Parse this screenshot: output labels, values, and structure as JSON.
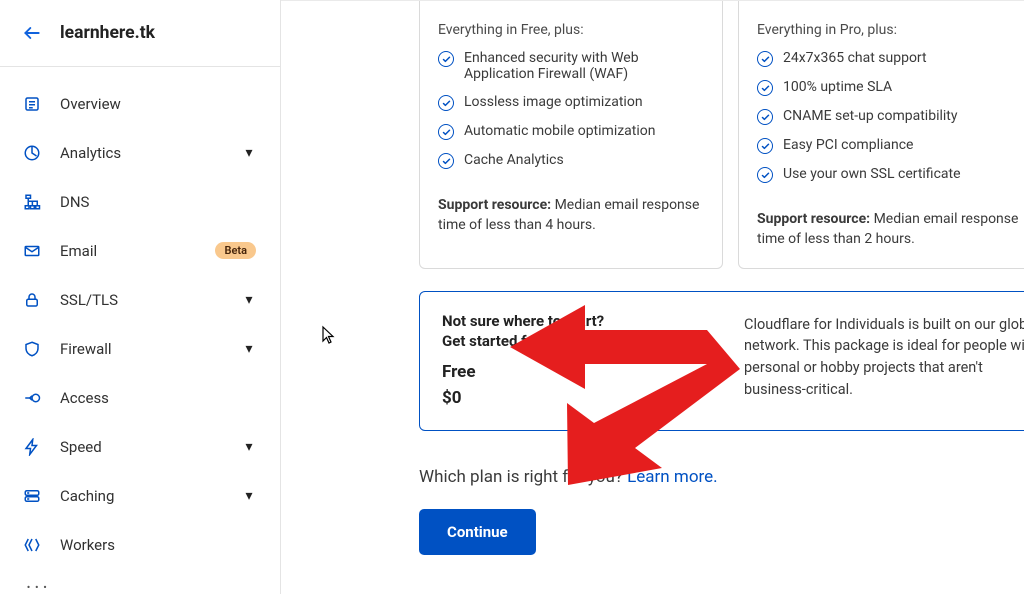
{
  "header": {
    "domain": "learnhere.tk"
  },
  "sidebar": {
    "items": [
      {
        "label": "Overview",
        "chevron": false,
        "icon": "overview"
      },
      {
        "label": "Analytics",
        "chevron": true,
        "icon": "analytics"
      },
      {
        "label": "DNS",
        "chevron": false,
        "icon": "dns"
      },
      {
        "label": "Email",
        "chevron": false,
        "icon": "email",
        "badge": "Beta"
      },
      {
        "label": "SSL/TLS",
        "chevron": true,
        "icon": "lock"
      },
      {
        "label": "Firewall",
        "chevron": true,
        "icon": "shield"
      },
      {
        "label": "Access",
        "chevron": false,
        "icon": "access"
      },
      {
        "label": "Speed",
        "chevron": true,
        "icon": "bolt"
      },
      {
        "label": "Caching",
        "chevron": true,
        "icon": "drive"
      },
      {
        "label": "Workers",
        "chevron": false,
        "icon": "workers"
      }
    ],
    "more": "..."
  },
  "plans": {
    "pro": {
      "subtitle": "Everything in Free, plus:",
      "features": [
        "Enhanced security with Web Application Firewall (WAF)",
        "Lossless image optimization",
        "Automatic mobile optimization",
        "Cache Analytics"
      ],
      "support_label": "Support resource:",
      "support_text": "Median email response time of less than 4 hours."
    },
    "business": {
      "subtitle": "Everything in Pro, plus:",
      "features": [
        "24x7x365 chat support",
        "100% uptime SLA",
        "CNAME set-up compatibility",
        "Easy PCI compliance",
        "Use your own SSL certificate"
      ],
      "support_label": "Support resource:",
      "support_text": "Median email response time of less than 2 hours."
    }
  },
  "free_box": {
    "line1": "Not sure where to start?",
    "line2": "Get started for free.",
    "plan": "Free",
    "price": "$0",
    "description": "Cloudflare for Individuals is built on our global network. This package is ideal for people with personal or hobby projects that aren't business-critical."
  },
  "bottom": {
    "which_text": "Which plan is right for you? ",
    "learn_text": "Learn more.",
    "continue_label": "Continue"
  }
}
